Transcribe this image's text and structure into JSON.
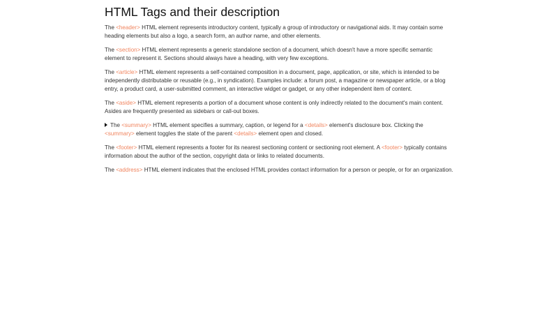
{
  "title": "HTML Tags and their description",
  "colors": {
    "tag": "#f0845e",
    "text": "#333333",
    "heading": "#111111"
  },
  "header_p": {
    "t1": "The ",
    "tag1": "<header>",
    "t2": " HTML element represents introductory content, typically a group of introductory or navigational aids. It may contain some heading elements but also a logo, a search form, an author name, and other elements."
  },
  "section_p": {
    "t1": "The ",
    "tag1": "<section>",
    "t2": " HTML element represents a generic standalone section of a document, which doesn't have a more specific semantic element to represent it. Sections should always have a heading, with very few exceptions."
  },
  "article_p": {
    "t1": "The ",
    "tag1": "<article>",
    "t2": " HTML element represents a self-contained composition in a document, page, application, or site, which is intended to be independently distributable or reusable (e.g., in syndication). Examples include: a forum post, a magazine or newspaper article, or a blog entry, a product card, a user-submitted comment, an interactive widget or gadget, or any other independent item of content."
  },
  "aside_p": {
    "t1": "The ",
    "tag1": "<aside>",
    "t2": " HTML element represents a portion of a document whose content is only indirectly related to the document's main content. Asides are frequently presented as sidebars or call-out boxes."
  },
  "summary_p": {
    "t1": "The ",
    "tag1": "<summary>",
    "t2": " HTML element specifies a summary, caption, or legend for a ",
    "tag2": "<details>",
    "t3": " element's disclosure box. Clicking the ",
    "tag3": "<summary>",
    "t4": " element toggles the state of the parent ",
    "tag4": "<details>",
    "t5": " element open and closed."
  },
  "footer_p": {
    "t1": "The ",
    "tag1": "<footer>",
    "t2": " HTML element represents a footer for its nearest sectioning content or sectioning root element. A ",
    "tag2": "<footer>",
    "t3": " typically contains information about the author of the section, copyright data or links to related documents."
  },
  "address_p": {
    "t1": "The ",
    "tag1": "<address>",
    "t2": " HTML element indicates that the enclosed HTML provides contact information for a person or people, or for an organization."
  }
}
